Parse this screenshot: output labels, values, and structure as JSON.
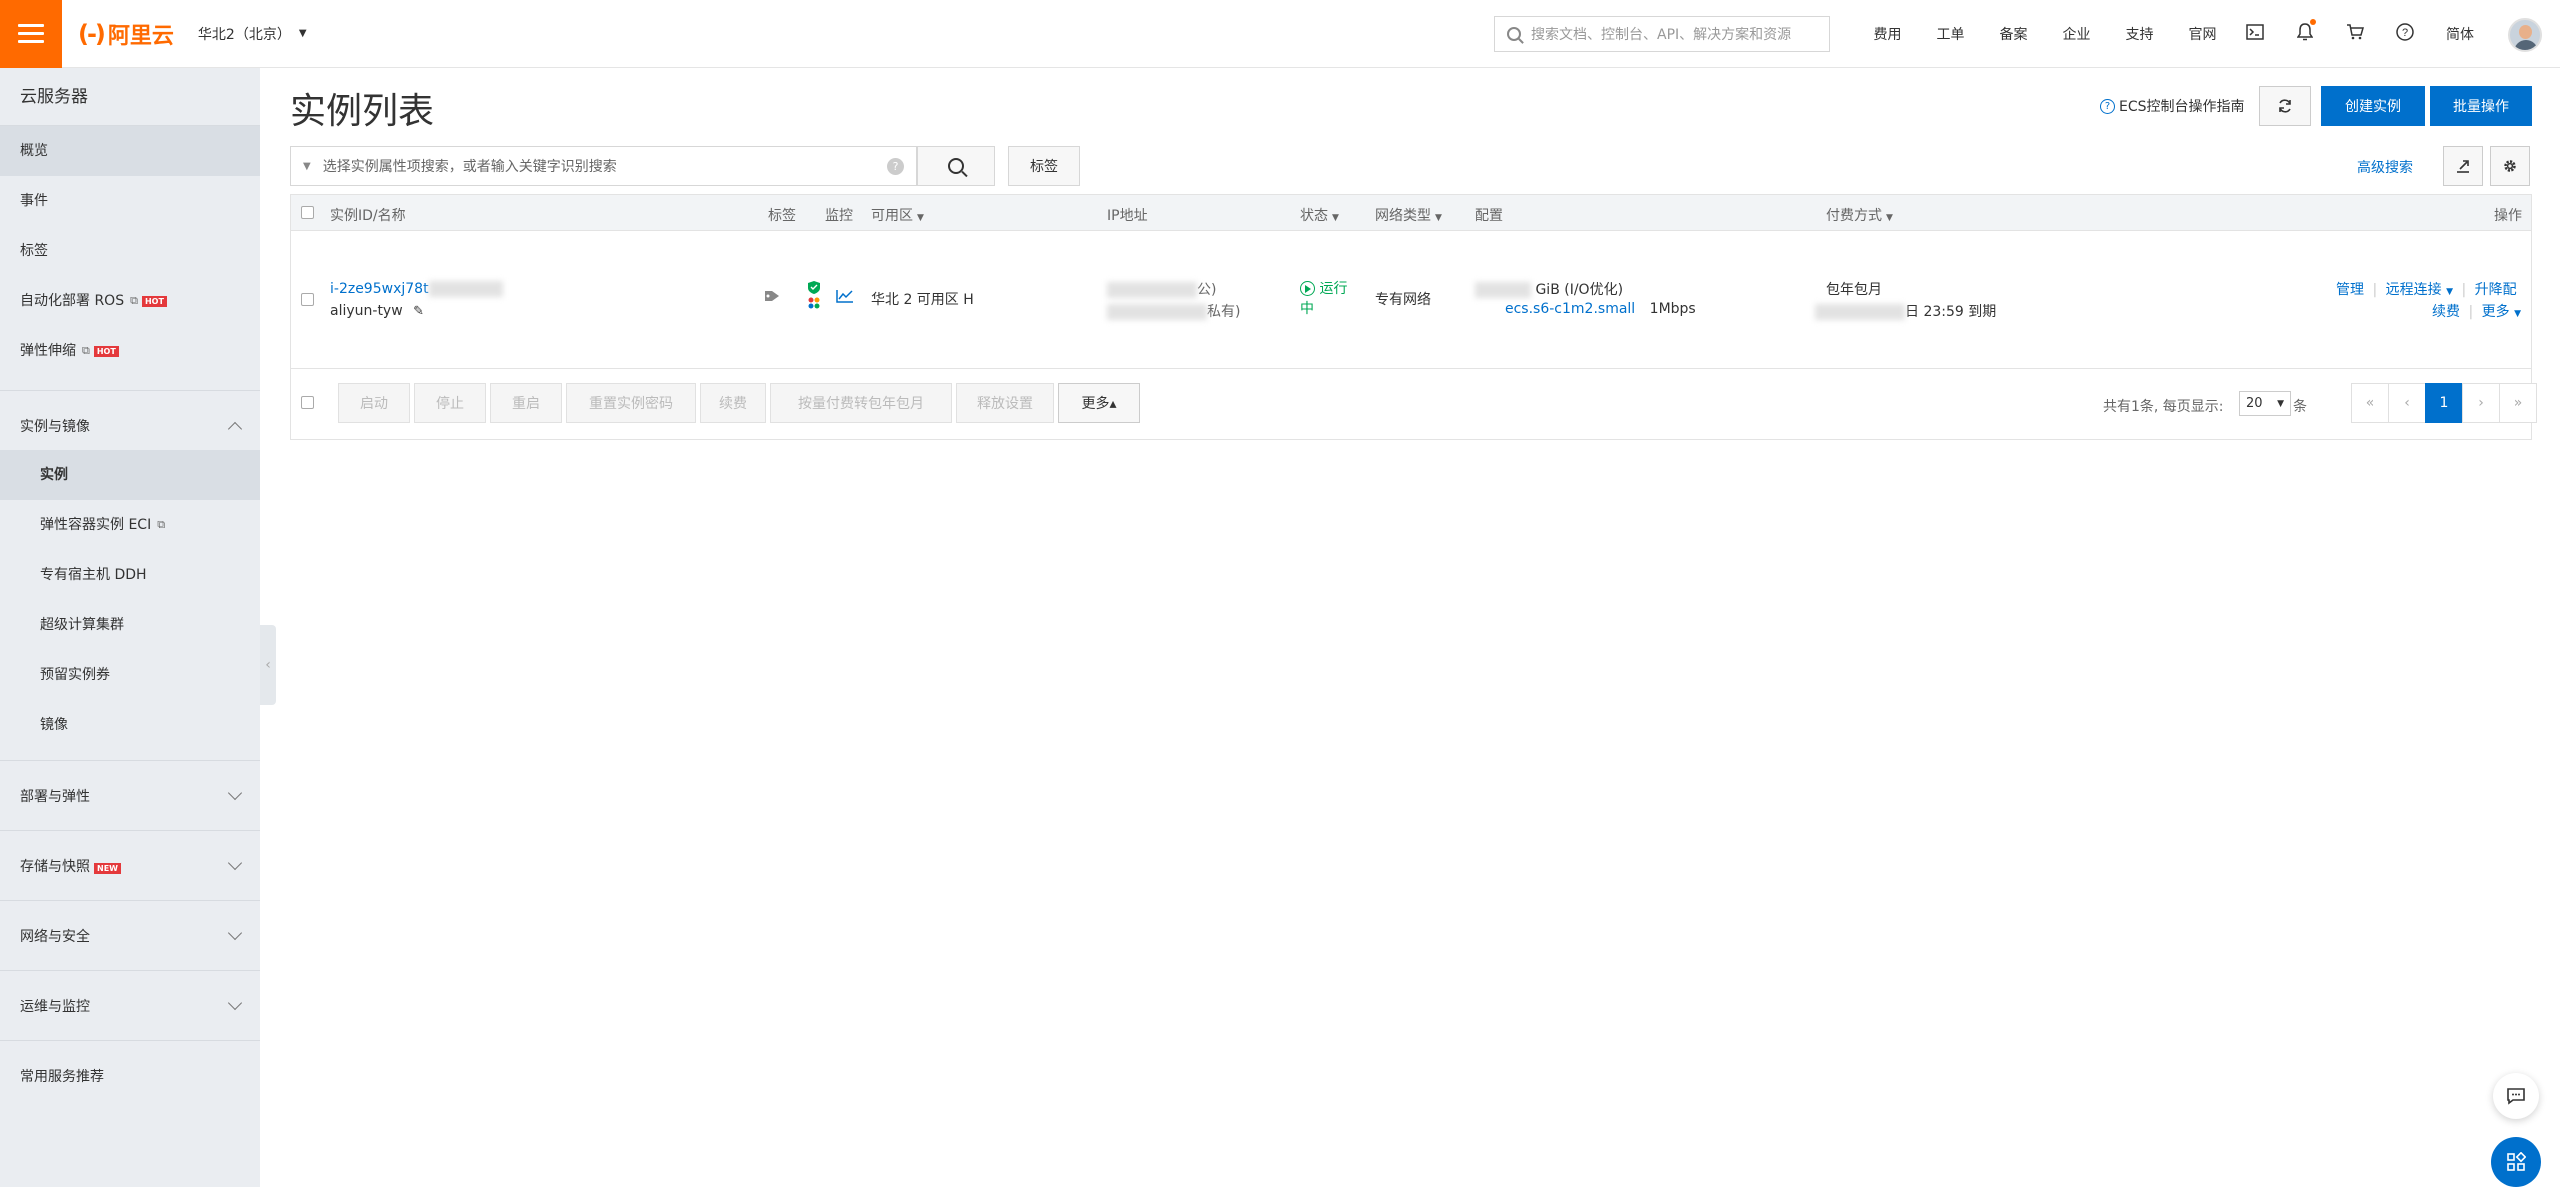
{
  "header": {
    "logo_mark": "(-)",
    "logo_text": "阿里云",
    "region": "华北2（北京）",
    "search_placeholder": "搜索文档、控制台、API、解决方案和资源",
    "nav": [
      "费用",
      "工单",
      "备案",
      "企业",
      "支持",
      "官网"
    ],
    "lang": "简体"
  },
  "sidebar": {
    "title": "云服务器",
    "top_items": [
      {
        "label": "概览"
      },
      {
        "label": "事件"
      },
      {
        "label": "标签"
      },
      {
        "label": "自动化部署 ROS",
        "badge": "HOT"
      },
      {
        "label": "弹性伸缩",
        "badge": "HOT"
      }
    ],
    "group_instances": "实例与镜像",
    "sub_items": [
      "实例",
      "弹性容器实例 ECI",
      "专有宿主机 DDH",
      "超级计算集群",
      "预留实例券",
      "镜像"
    ],
    "groups": [
      {
        "label": "部署与弹性"
      },
      {
        "label": "存储与快照",
        "badge": "NEW"
      },
      {
        "label": "网络与安全"
      },
      {
        "label": "运维与监控"
      }
    ],
    "recommend": "常用服务推荐"
  },
  "main": {
    "title": "实例列表",
    "guide": "ECS控制台操作指南",
    "create": "创建实例",
    "batch": "批量操作",
    "filter_placeholder": "选择实例属性项搜索，或者输入关键字识别搜索",
    "tag_btn": "标签",
    "advanced": "高级搜索"
  },
  "table": {
    "headers": {
      "id": "实例ID/名称",
      "tag": "标签",
      "monitor": "监控",
      "zone": "可用区",
      "ip": "IP地址",
      "status": "状态",
      "network": "网络类型",
      "config": "配置",
      "billing": "付费方式",
      "actions": "操作"
    },
    "row": {
      "id": "i-2ze95wxj78t",
      "name": "aliyun-tyw",
      "zone": "华北 2 可用区 H",
      "ip_public_suffix": "公)",
      "ip_private_suffix": "私有)",
      "status": "运行中",
      "status_line1": "运行",
      "status_line2": "中",
      "network": "专有网络",
      "config_line1": "GiB (I/O优化)",
      "config_type": "ecs.s6-c1m2.small",
      "config_bw": "1Mbps",
      "billing_line1": "包年包月",
      "billing_line2": "日 23:59 到期",
      "actions": {
        "manage": "管理",
        "remote": "远程连接",
        "upgrade": "升降配",
        "renew": "续费",
        "more": "更多"
      }
    },
    "footer": {
      "buttons": [
        "启动",
        "停止",
        "重启",
        "重置实例密码",
        "续费",
        "按量付费转包年包月",
        "释放设置"
      ],
      "more": "更多▴",
      "total": "共有1条, 每页显示:",
      "page_size": "20",
      "page_unit": "条",
      "first": "«",
      "prev": "‹",
      "current": "1",
      "next": "›",
      "last": "»"
    }
  }
}
